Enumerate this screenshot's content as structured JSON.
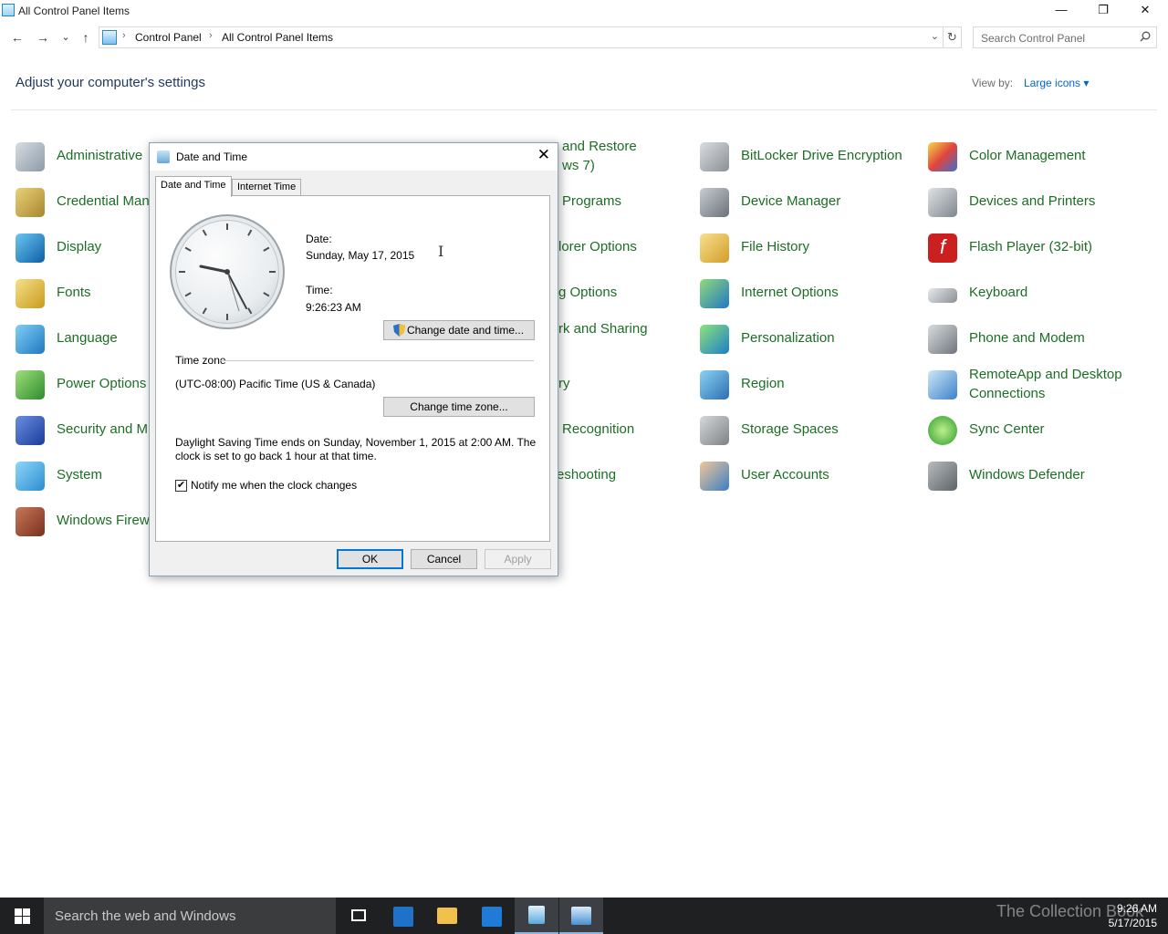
{
  "window": {
    "title": "All Control Panel Items",
    "minimize": "—",
    "restore": "❐",
    "close": "✕"
  },
  "nav": {
    "back": "←",
    "forward": "→",
    "recent": "⌄",
    "up": "↑"
  },
  "address": {
    "crumbs": [
      "Control Panel",
      "All Control Panel Items"
    ],
    "sep": "›",
    "dropdown": "⌄",
    "refresh": "↻"
  },
  "search": {
    "placeholder": "Search Control Panel"
  },
  "main": {
    "heading": "Adjust your computer's settings",
    "view_by_label": "View by:",
    "view_by_value": "Large icons ▾"
  },
  "items": {
    "col1": [
      "Administrative",
      "Credential Man",
      "Display",
      "Fonts",
      "Language",
      "Power Options",
      "Security and M",
      "System",
      "Windows Firew"
    ],
    "col2_partial": [
      "and Restore",
      "ws 7)",
      "Programs",
      "lorer Options",
      "g Options",
      "rk and Sharing",
      "ry",
      "Recognition",
      "eshooting"
    ],
    "col3": [
      "BitLocker Drive Encryption",
      "Device Manager",
      "File History",
      "Internet Options",
      "Personalization",
      "Region",
      "Storage Spaces",
      "User Accounts"
    ],
    "col4": [
      "Color Management",
      "Devices and Printers",
      "Flash Player (32-bit)",
      "Keyboard",
      "Phone and Modem",
      "RemoteApp and Desktop",
      "Connections",
      "Sync Center",
      "Windows Defender"
    ]
  },
  "dialog": {
    "title": "Date and Time",
    "close": "✕",
    "tabs": [
      "Date and Time",
      "Internet Time"
    ],
    "date_label": "Date:",
    "date_value": "Sunday, May 17, 2015",
    "time_label": "Time:",
    "time_value": "9:26:23 AM",
    "change_dt_button": "Change date and time...",
    "tz_label": "Time zone",
    "tz_value": "(UTC-08:00) Pacific Time (US & Canada)",
    "change_tz_button": "Change time zone...",
    "dst_text": "Daylight Saving Time ends on Sunday, November 1, 2015 at 2:00 AM. The clock is set to go back 1 hour at that time.",
    "notify_label": "Notify me when the clock changes",
    "notify_checked": "✔",
    "ok": "OK",
    "cancel": "Cancel",
    "apply": "Apply"
  },
  "taskbar": {
    "search_placeholder": "Search the web and Windows",
    "time": "9:26 AM",
    "date": "5/17/2015",
    "watermark": "The Collection Book"
  }
}
